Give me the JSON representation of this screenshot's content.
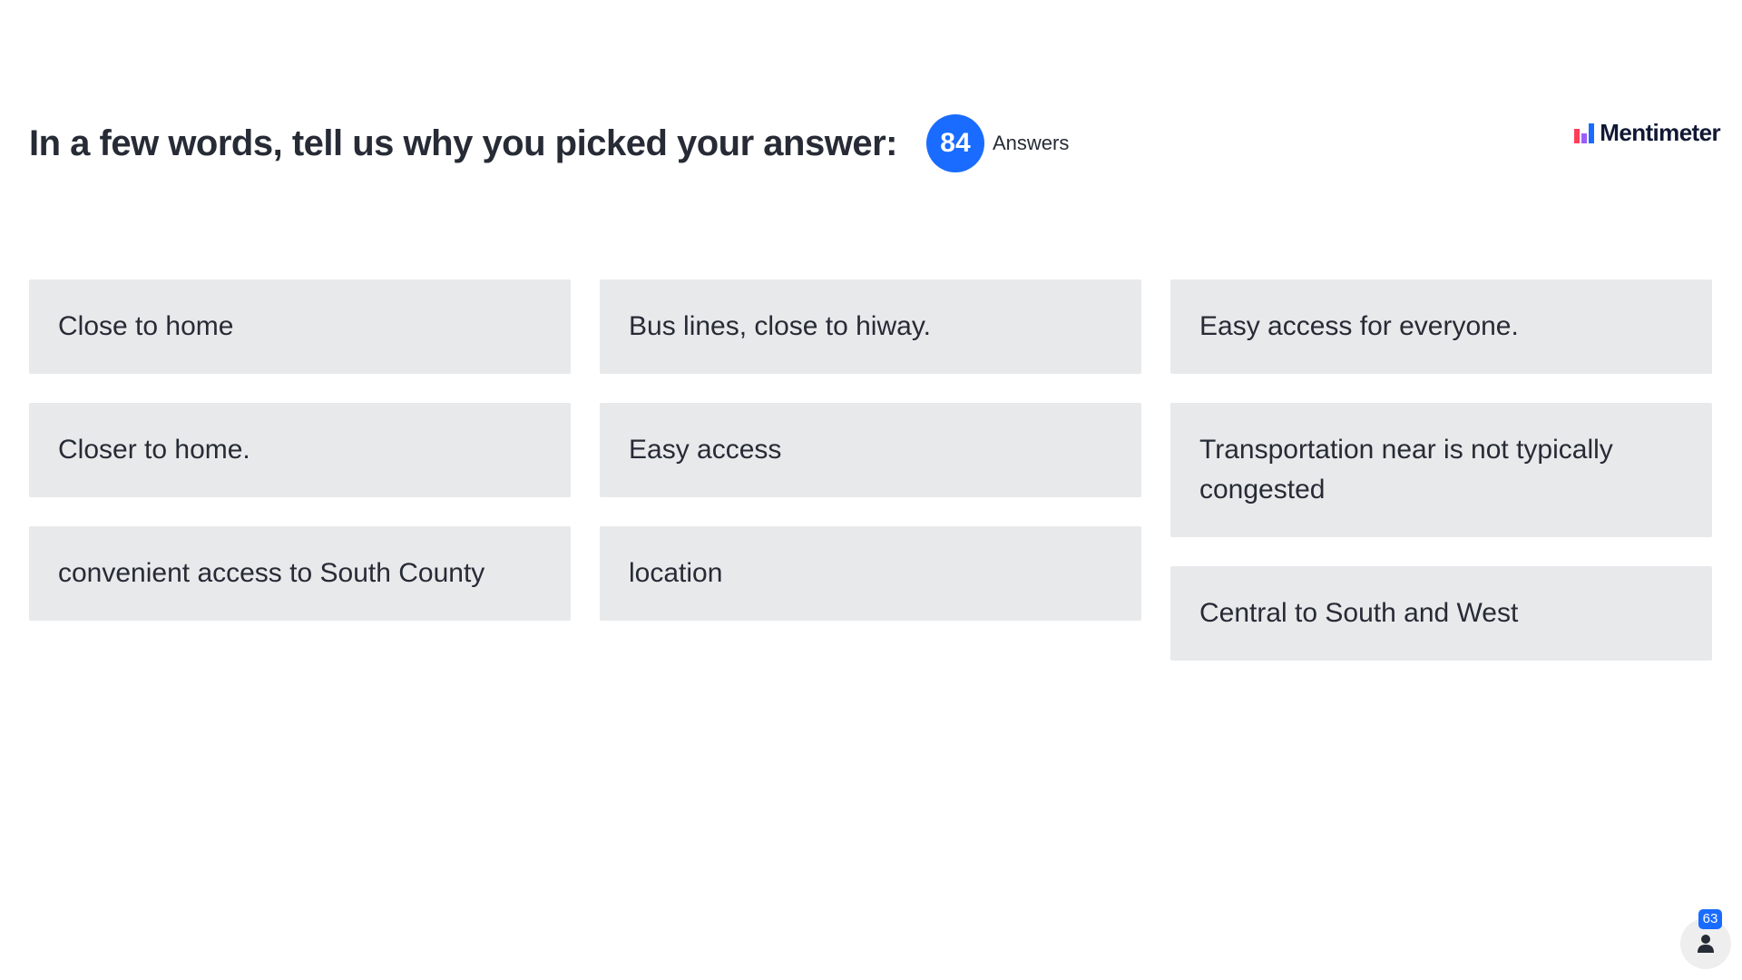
{
  "header": {
    "question": "In a few words, tell us why you picked your answer:",
    "answer_count": "84",
    "answer_count_label": "Answers"
  },
  "logo": {
    "text": "Mentimeter",
    "icon": "mentimeter-bars-icon",
    "colors": [
      "#ff3e5a",
      "#9b5cff",
      "#196cff"
    ]
  },
  "responses": {
    "columns": [
      [
        "Close to home",
        "Closer to home.",
        "convenient access to South County"
      ],
      [
        "Bus lines, close to hiway.",
        "Easy access",
        "location"
      ],
      [
        "Easy access for everyone.",
        "Transportation near is not typically congested",
        "Central to South and West"
      ]
    ]
  },
  "participants": {
    "count": "63",
    "icon": "person-icon"
  },
  "colors": {
    "accent": "#196cff",
    "card_background": "#e8e9eb",
    "text": "#262b35"
  }
}
